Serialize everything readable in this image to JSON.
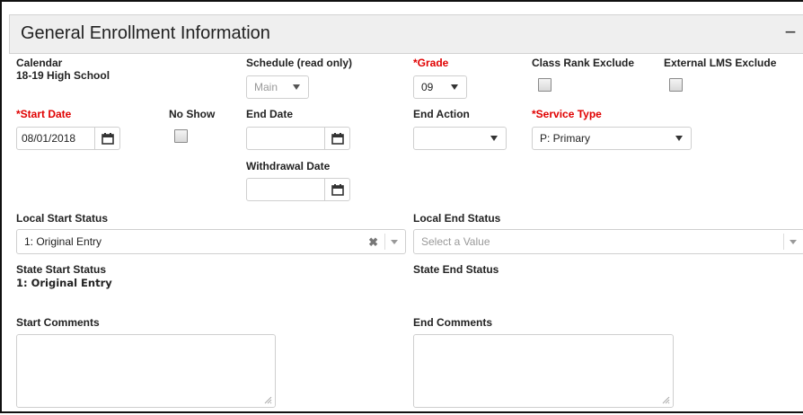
{
  "header": {
    "title": "General Enrollment Information",
    "collapse_label": "−"
  },
  "calendar": {
    "label": "Calendar",
    "value": "18-19 High School"
  },
  "schedule": {
    "label": "Schedule (read only)",
    "value": "Main"
  },
  "grade": {
    "label": "*Grade",
    "value": "09"
  },
  "class_rank_exclude": {
    "label": "Class Rank Exclude",
    "checked": false
  },
  "external_lms_exclude": {
    "label": "External LMS Exclude",
    "checked": false
  },
  "start_date": {
    "label": "*Start Date",
    "value": "08/01/2018"
  },
  "no_show": {
    "label": "No Show",
    "checked": false
  },
  "end_date": {
    "label": "End Date",
    "value": ""
  },
  "end_action": {
    "label": "End Action",
    "value": ""
  },
  "service_type": {
    "label": "*Service Type",
    "value": "P: Primary"
  },
  "withdrawal_date": {
    "label": "Withdrawal Date",
    "value": ""
  },
  "local_start_status": {
    "label": "Local Start Status",
    "value": "1: Original Entry"
  },
  "local_end_status": {
    "label": "Local End Status",
    "placeholder": "Select a Value"
  },
  "state_start_status": {
    "label": "State Start Status",
    "value": "1: Original Entry"
  },
  "state_end_status": {
    "label": "State End Status",
    "value": ""
  },
  "start_comments": {
    "label": "Start Comments",
    "value": ""
  },
  "end_comments": {
    "label": "End Comments",
    "value": ""
  },
  "icons": {
    "calendar": "calendar-icon",
    "clear": "clear-icon",
    "checkbox": "checkbox"
  },
  "colors": {
    "required": "#e00000",
    "header_bg": "#efefef",
    "border": "#cfcfcf"
  }
}
